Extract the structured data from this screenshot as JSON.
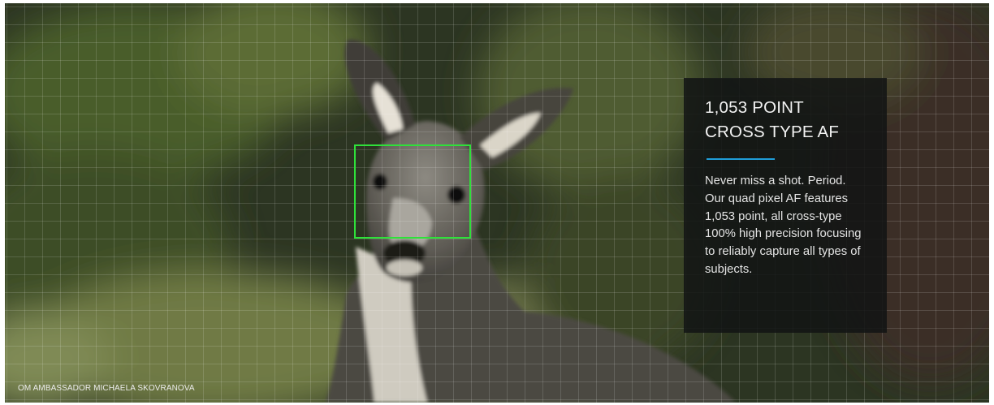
{
  "feature": {
    "title_line1": "1,053 POINT",
    "title_line2": "CROSS TYPE AF",
    "description": "Never miss a shot. Period. Our quad pixel AF features 1,053 point, all cross-type 100% high precision focusing to reliably capture all types of subjects."
  },
  "photo": {
    "credit": "OM AMBASSADOR MICHAELA SKOVRANOVA",
    "subject": "kangaroo"
  },
  "colors": {
    "af_box": "#2fe03a",
    "accent_line": "#1f9dd8",
    "panel_bg": "#121414"
  }
}
